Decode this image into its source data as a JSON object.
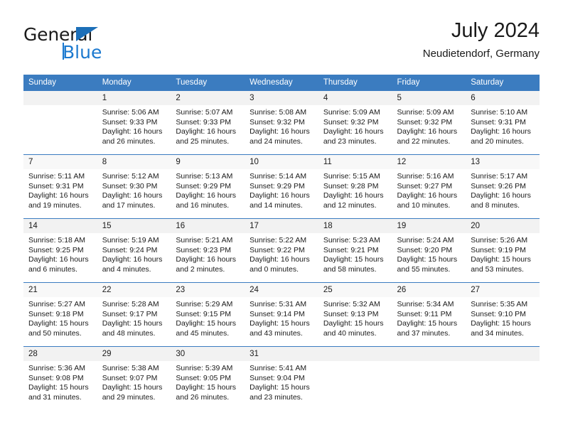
{
  "brand": {
    "word_one": "General",
    "word_two": "Blue",
    "accent_color": "#1b79cf",
    "triangle_icon": "logo-triangle-icon"
  },
  "header": {
    "title": "July 2024",
    "subtitle": "Neudietendorf, Germany"
  },
  "theme": {
    "header_row_bg": "#3b7cc0",
    "header_row_text": "#ffffff",
    "daynum_band_bg": "#f2f2f2",
    "row_divider": "#3b7cc0",
    "body_text": "#1a1a1a"
  },
  "weekday_headers": [
    "Sunday",
    "Monday",
    "Tuesday",
    "Wednesday",
    "Thursday",
    "Friday",
    "Saturday"
  ],
  "weeks": [
    {
      "days": [
        {
          "date": "",
          "sunrise": "",
          "sunset": "",
          "daylight_1": "",
          "daylight_2": ""
        },
        {
          "date": "1",
          "sunrise": "Sunrise: 5:06 AM",
          "sunset": "Sunset: 9:33 PM",
          "daylight_1": "Daylight: 16 hours",
          "daylight_2": "and 26 minutes."
        },
        {
          "date": "2",
          "sunrise": "Sunrise: 5:07 AM",
          "sunset": "Sunset: 9:33 PM",
          "daylight_1": "Daylight: 16 hours",
          "daylight_2": "and 25 minutes."
        },
        {
          "date": "3",
          "sunrise": "Sunrise: 5:08 AM",
          "sunset": "Sunset: 9:32 PM",
          "daylight_1": "Daylight: 16 hours",
          "daylight_2": "and 24 minutes."
        },
        {
          "date": "4",
          "sunrise": "Sunrise: 5:09 AM",
          "sunset": "Sunset: 9:32 PM",
          "daylight_1": "Daylight: 16 hours",
          "daylight_2": "and 23 minutes."
        },
        {
          "date": "5",
          "sunrise": "Sunrise: 5:09 AM",
          "sunset": "Sunset: 9:32 PM",
          "daylight_1": "Daylight: 16 hours",
          "daylight_2": "and 22 minutes."
        },
        {
          "date": "6",
          "sunrise": "Sunrise: 5:10 AM",
          "sunset": "Sunset: 9:31 PM",
          "daylight_1": "Daylight: 16 hours",
          "daylight_2": "and 20 minutes."
        }
      ]
    },
    {
      "days": [
        {
          "date": "7",
          "sunrise": "Sunrise: 5:11 AM",
          "sunset": "Sunset: 9:31 PM",
          "daylight_1": "Daylight: 16 hours",
          "daylight_2": "and 19 minutes."
        },
        {
          "date": "8",
          "sunrise": "Sunrise: 5:12 AM",
          "sunset": "Sunset: 9:30 PM",
          "daylight_1": "Daylight: 16 hours",
          "daylight_2": "and 17 minutes."
        },
        {
          "date": "9",
          "sunrise": "Sunrise: 5:13 AM",
          "sunset": "Sunset: 9:29 PM",
          "daylight_1": "Daylight: 16 hours",
          "daylight_2": "and 16 minutes."
        },
        {
          "date": "10",
          "sunrise": "Sunrise: 5:14 AM",
          "sunset": "Sunset: 9:29 PM",
          "daylight_1": "Daylight: 16 hours",
          "daylight_2": "and 14 minutes."
        },
        {
          "date": "11",
          "sunrise": "Sunrise: 5:15 AM",
          "sunset": "Sunset: 9:28 PM",
          "daylight_1": "Daylight: 16 hours",
          "daylight_2": "and 12 minutes."
        },
        {
          "date": "12",
          "sunrise": "Sunrise: 5:16 AM",
          "sunset": "Sunset: 9:27 PM",
          "daylight_1": "Daylight: 16 hours",
          "daylight_2": "and 10 minutes."
        },
        {
          "date": "13",
          "sunrise": "Sunrise: 5:17 AM",
          "sunset": "Sunset: 9:26 PM",
          "daylight_1": "Daylight: 16 hours",
          "daylight_2": "and 8 minutes."
        }
      ]
    },
    {
      "days": [
        {
          "date": "14",
          "sunrise": "Sunrise: 5:18 AM",
          "sunset": "Sunset: 9:25 PM",
          "daylight_1": "Daylight: 16 hours",
          "daylight_2": "and 6 minutes."
        },
        {
          "date": "15",
          "sunrise": "Sunrise: 5:19 AM",
          "sunset": "Sunset: 9:24 PM",
          "daylight_1": "Daylight: 16 hours",
          "daylight_2": "and 4 minutes."
        },
        {
          "date": "16",
          "sunrise": "Sunrise: 5:21 AM",
          "sunset": "Sunset: 9:23 PM",
          "daylight_1": "Daylight: 16 hours",
          "daylight_2": "and 2 minutes."
        },
        {
          "date": "17",
          "sunrise": "Sunrise: 5:22 AM",
          "sunset": "Sunset: 9:22 PM",
          "daylight_1": "Daylight: 16 hours",
          "daylight_2": "and 0 minutes."
        },
        {
          "date": "18",
          "sunrise": "Sunrise: 5:23 AM",
          "sunset": "Sunset: 9:21 PM",
          "daylight_1": "Daylight: 15 hours",
          "daylight_2": "and 58 minutes."
        },
        {
          "date": "19",
          "sunrise": "Sunrise: 5:24 AM",
          "sunset": "Sunset: 9:20 PM",
          "daylight_1": "Daylight: 15 hours",
          "daylight_2": "and 55 minutes."
        },
        {
          "date": "20",
          "sunrise": "Sunrise: 5:26 AM",
          "sunset": "Sunset: 9:19 PM",
          "daylight_1": "Daylight: 15 hours",
          "daylight_2": "and 53 minutes."
        }
      ]
    },
    {
      "days": [
        {
          "date": "21",
          "sunrise": "Sunrise: 5:27 AM",
          "sunset": "Sunset: 9:18 PM",
          "daylight_1": "Daylight: 15 hours",
          "daylight_2": "and 50 minutes."
        },
        {
          "date": "22",
          "sunrise": "Sunrise: 5:28 AM",
          "sunset": "Sunset: 9:17 PM",
          "daylight_1": "Daylight: 15 hours",
          "daylight_2": "and 48 minutes."
        },
        {
          "date": "23",
          "sunrise": "Sunrise: 5:29 AM",
          "sunset": "Sunset: 9:15 PM",
          "daylight_1": "Daylight: 15 hours",
          "daylight_2": "and 45 minutes."
        },
        {
          "date": "24",
          "sunrise": "Sunrise: 5:31 AM",
          "sunset": "Sunset: 9:14 PM",
          "daylight_1": "Daylight: 15 hours",
          "daylight_2": "and 43 minutes."
        },
        {
          "date": "25",
          "sunrise": "Sunrise: 5:32 AM",
          "sunset": "Sunset: 9:13 PM",
          "daylight_1": "Daylight: 15 hours",
          "daylight_2": "and 40 minutes."
        },
        {
          "date": "26",
          "sunrise": "Sunrise: 5:34 AM",
          "sunset": "Sunset: 9:11 PM",
          "daylight_1": "Daylight: 15 hours",
          "daylight_2": "and 37 minutes."
        },
        {
          "date": "27",
          "sunrise": "Sunrise: 5:35 AM",
          "sunset": "Sunset: 9:10 PM",
          "daylight_1": "Daylight: 15 hours",
          "daylight_2": "and 34 minutes."
        }
      ]
    },
    {
      "days": [
        {
          "date": "28",
          "sunrise": "Sunrise: 5:36 AM",
          "sunset": "Sunset: 9:08 PM",
          "daylight_1": "Daylight: 15 hours",
          "daylight_2": "and 31 minutes."
        },
        {
          "date": "29",
          "sunrise": "Sunrise: 5:38 AM",
          "sunset": "Sunset: 9:07 PM",
          "daylight_1": "Daylight: 15 hours",
          "daylight_2": "and 29 minutes."
        },
        {
          "date": "30",
          "sunrise": "Sunrise: 5:39 AM",
          "sunset": "Sunset: 9:05 PM",
          "daylight_1": "Daylight: 15 hours",
          "daylight_2": "and 26 minutes."
        },
        {
          "date": "31",
          "sunrise": "Sunrise: 5:41 AM",
          "sunset": "Sunset: 9:04 PM",
          "daylight_1": "Daylight: 15 hours",
          "daylight_2": "and 23 minutes."
        },
        {
          "date": "",
          "sunrise": "",
          "sunset": "",
          "daylight_1": "",
          "daylight_2": ""
        },
        {
          "date": "",
          "sunrise": "",
          "sunset": "",
          "daylight_1": "",
          "daylight_2": ""
        },
        {
          "date": "",
          "sunrise": "",
          "sunset": "",
          "daylight_1": "",
          "daylight_2": ""
        }
      ]
    }
  ]
}
